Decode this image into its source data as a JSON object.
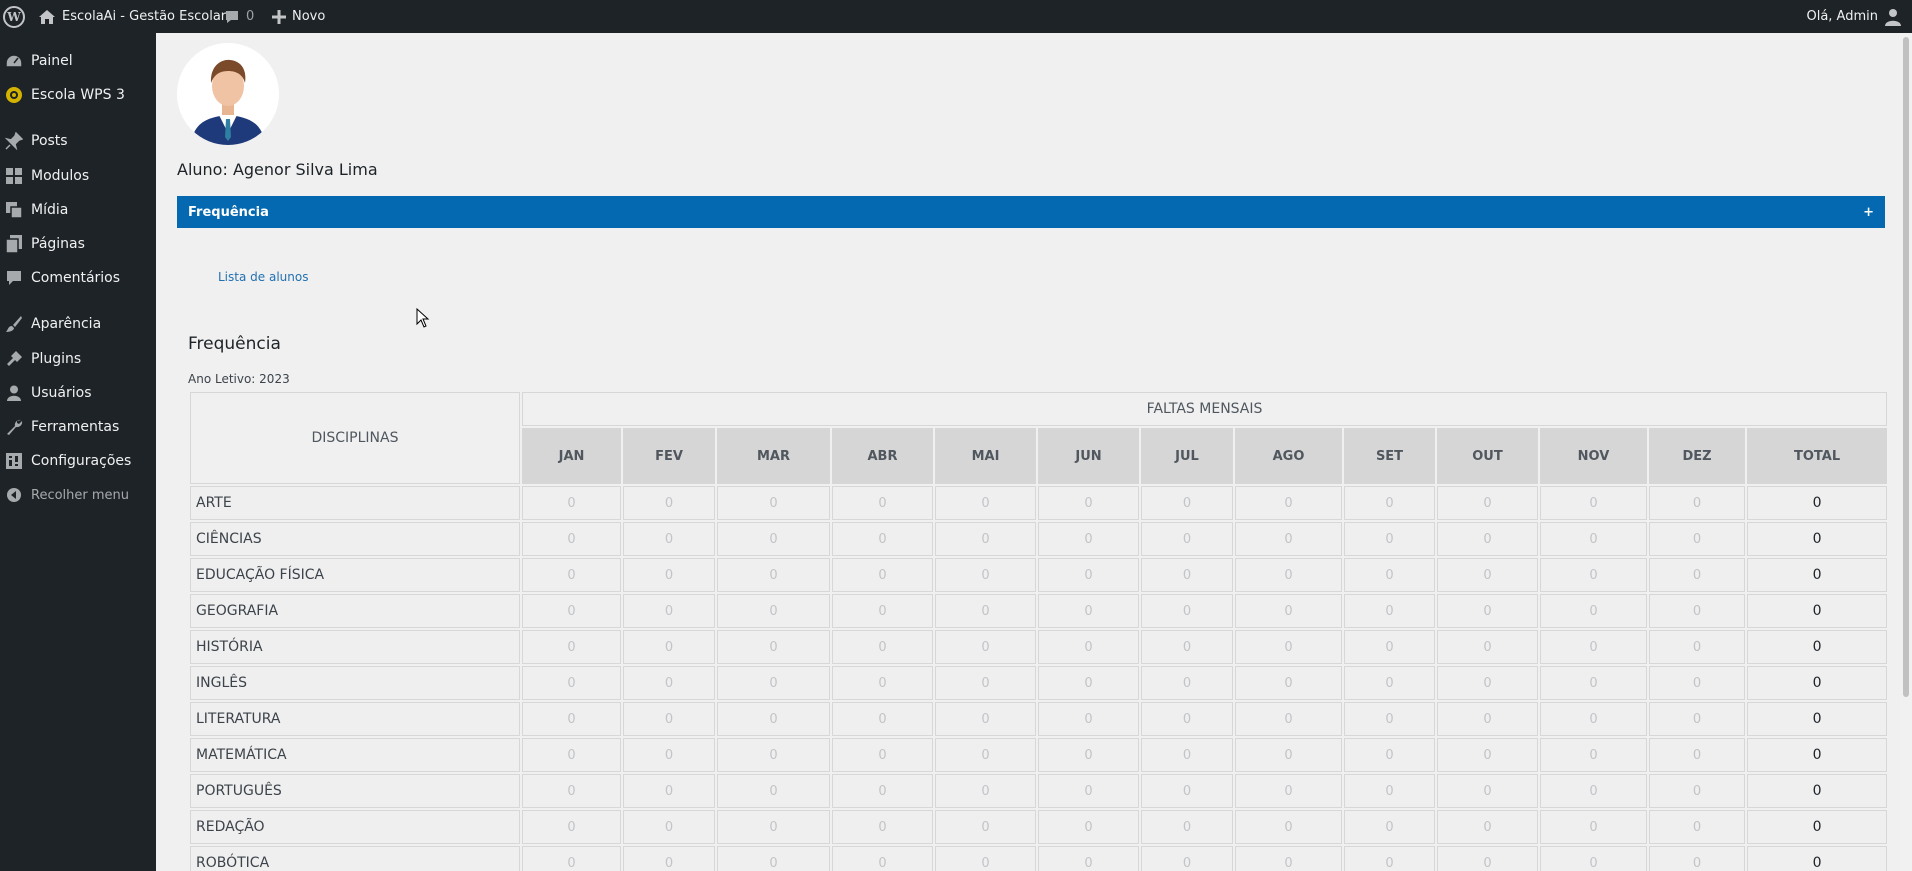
{
  "adminbar": {
    "site_name": "EscolaAi - Gestão Escolar",
    "comments_count": "0",
    "new_label": "Novo",
    "greeting": "Olá, Admin"
  },
  "sidebar": {
    "items": [
      {
        "label": "Painel",
        "icon": "dashboard-icon"
      },
      {
        "label": "Escola WPS 3",
        "icon": "school-icon"
      },
      {
        "label": "Posts",
        "icon": "pin-icon"
      },
      {
        "label": "Modulos",
        "icon": "grid-icon"
      },
      {
        "label": "Mídia",
        "icon": "media-icon"
      },
      {
        "label": "Páginas",
        "icon": "pages-icon"
      },
      {
        "label": "Comentários",
        "icon": "comment-icon"
      },
      {
        "label": "Aparência",
        "icon": "brush-icon"
      },
      {
        "label": "Plugins",
        "icon": "plug-icon"
      },
      {
        "label": "Usuários",
        "icon": "user-icon"
      },
      {
        "label": "Ferramentas",
        "icon": "wrench-icon"
      },
      {
        "label": "Configurações",
        "icon": "settings-icon"
      },
      {
        "label": "Recolher menu",
        "icon": "collapse-icon"
      }
    ]
  },
  "student": {
    "name_label": "Aluno: Agenor Silva Lima"
  },
  "accordion": {
    "title": "Frequência",
    "toggle": "+"
  },
  "links": {
    "student_list": "Lista de alunos"
  },
  "frequency": {
    "title": "Frequência",
    "year_label": "Ano Letivo: 2023",
    "header_group": "FALTAS MENSAIS",
    "header_subjects": "DISCIPLINAS",
    "months": [
      "JAN",
      "FEV",
      "MAR",
      "ABR",
      "MAI",
      "JUN",
      "JUL",
      "AGO",
      "SET",
      "OUT",
      "NOV",
      "DEZ"
    ],
    "total_label": "TOTAL",
    "rows": [
      {
        "subject": "ARTE",
        "values": [
          "0",
          "0",
          "0",
          "0",
          "0",
          "0",
          "0",
          "0",
          "0",
          "0",
          "0",
          "0"
        ],
        "total": "0"
      },
      {
        "subject": "CIÊNCIAS",
        "values": [
          "0",
          "0",
          "0",
          "0",
          "0",
          "0",
          "0",
          "0",
          "0",
          "0",
          "0",
          "0"
        ],
        "total": "0"
      },
      {
        "subject": "EDUCAÇÃO FÍSICA",
        "values": [
          "0",
          "0",
          "0",
          "0",
          "0",
          "0",
          "0",
          "0",
          "0",
          "0",
          "0",
          "0"
        ],
        "total": "0"
      },
      {
        "subject": "GEOGRAFIA",
        "values": [
          "0",
          "0",
          "0",
          "0",
          "0",
          "0",
          "0",
          "0",
          "0",
          "0",
          "0",
          "0"
        ],
        "total": "0"
      },
      {
        "subject": "HISTÓRIA",
        "values": [
          "0",
          "0",
          "0",
          "0",
          "0",
          "0",
          "0",
          "0",
          "0",
          "0",
          "0",
          "0"
        ],
        "total": "0"
      },
      {
        "subject": "INGLÊS",
        "values": [
          "0",
          "0",
          "0",
          "0",
          "0",
          "0",
          "0",
          "0",
          "0",
          "0",
          "0",
          "0"
        ],
        "total": "0"
      },
      {
        "subject": "LITERATURA",
        "values": [
          "0",
          "0",
          "0",
          "0",
          "0",
          "0",
          "0",
          "0",
          "0",
          "0",
          "0",
          "0"
        ],
        "total": "0"
      },
      {
        "subject": "MATEMÁTICA",
        "values": [
          "0",
          "0",
          "0",
          "0",
          "0",
          "0",
          "0",
          "0",
          "0",
          "0",
          "0",
          "0"
        ],
        "total": "0"
      },
      {
        "subject": "PORTUGUÊS",
        "values": [
          "0",
          "0",
          "0",
          "0",
          "0",
          "0",
          "0",
          "0",
          "0",
          "0",
          "0",
          "0"
        ],
        "total": "0"
      },
      {
        "subject": "REDAÇÃO",
        "values": [
          "0",
          "0",
          "0",
          "0",
          "0",
          "0",
          "0",
          "0",
          "0",
          "0",
          "0",
          "0"
        ],
        "total": "0"
      },
      {
        "subject": "ROBÓTICA",
        "values": [
          "0",
          "0",
          "0",
          "0",
          "0",
          "0",
          "0",
          "0",
          "0",
          "0",
          "0",
          "0"
        ],
        "total": "0"
      }
    ]
  },
  "colors": {
    "adminbar_bg": "#1d2327",
    "accordion_bg": "#0469b0",
    "link": "#2271b1"
  }
}
